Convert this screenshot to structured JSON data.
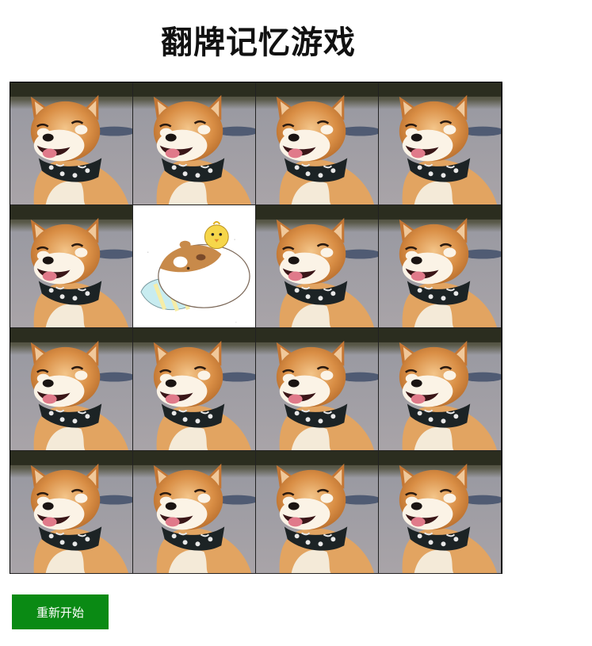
{
  "game": {
    "title": "翻牌记忆游戏",
    "restart_label": "重新开始"
  },
  "board": {
    "rows": 4,
    "cols": 4,
    "cards": [
      {
        "face": "back",
        "image": "shiba-dog-photo"
      },
      {
        "face": "back",
        "image": "shiba-dog-photo"
      },
      {
        "face": "back",
        "image": "shiba-dog-photo"
      },
      {
        "face": "back",
        "image": "shiba-dog-photo"
      },
      {
        "face": "back",
        "image": "shiba-dog-photo"
      },
      {
        "face": "up",
        "image": "hamster-chick-cartoon"
      },
      {
        "face": "back",
        "image": "shiba-dog-photo"
      },
      {
        "face": "back",
        "image": "shiba-dog-photo"
      },
      {
        "face": "back",
        "image": "shiba-dog-photo"
      },
      {
        "face": "back",
        "image": "shiba-dog-photo"
      },
      {
        "face": "back",
        "image": "shiba-dog-photo"
      },
      {
        "face": "back",
        "image": "shiba-dog-photo"
      },
      {
        "face": "back",
        "image": "shiba-dog-photo"
      },
      {
        "face": "back",
        "image": "shiba-dog-photo"
      },
      {
        "face": "back",
        "image": "shiba-dog-photo"
      },
      {
        "face": "back",
        "image": "shiba-dog-photo"
      }
    ]
  },
  "colors": {
    "button_bg": "#0a8a14",
    "button_text": "#ffffff"
  }
}
